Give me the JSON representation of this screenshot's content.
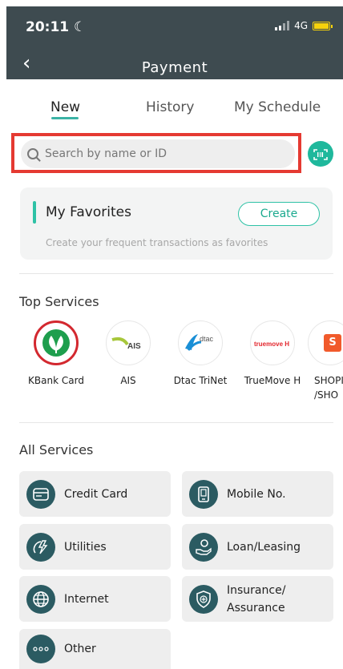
{
  "status": {
    "time": "20:11 ☾",
    "network": "4G"
  },
  "header": {
    "title": "Payment",
    "back_label": "‹"
  },
  "tabs": [
    {
      "label": "New",
      "active": true
    },
    {
      "label": "History",
      "active": false
    },
    {
      "label": "My Schedule",
      "active": false
    }
  ],
  "search": {
    "placeholder": "Search by name or ID",
    "value": ""
  },
  "favorites": {
    "title": "My Favorites",
    "create_label": "Create",
    "description": "Create your frequent transactions as favorites"
  },
  "top_services": {
    "title": "Top Services",
    "items": [
      {
        "label": "KBank Card",
        "logo_text": ""
      },
      {
        "label": "AIS",
        "logo_text": "AIS"
      },
      {
        "label": "Dtac TriNet",
        "logo_text": "dtac"
      },
      {
        "label": "TrueMove H",
        "logo_text": "truemove H"
      },
      {
        "label": "SHOPI /SHO",
        "logo_text": "S"
      }
    ]
  },
  "all_services": {
    "title": "All Services",
    "items": [
      {
        "label": "Credit Card",
        "icon": "credit-card-icon"
      },
      {
        "label": "Mobile No.",
        "icon": "mobile-icon"
      },
      {
        "label": "Utilities",
        "icon": "utilities-icon"
      },
      {
        "label": "Loan/Leasing",
        "icon": "loan-icon"
      },
      {
        "label": "Internet",
        "icon": "globe-icon"
      },
      {
        "label": "Insurance/ Assurance",
        "icon": "shield-icon"
      },
      {
        "label": "Other",
        "icon": "more-icon"
      }
    ]
  },
  "colors": {
    "header_bg": "#3e4b50",
    "accent": "#2ec2a6",
    "highlight": "#e53a32",
    "category_icon_bg": "#2b5b62",
    "kbank_green": "#1e9e4d",
    "kbank_red": "#d3282f"
  }
}
